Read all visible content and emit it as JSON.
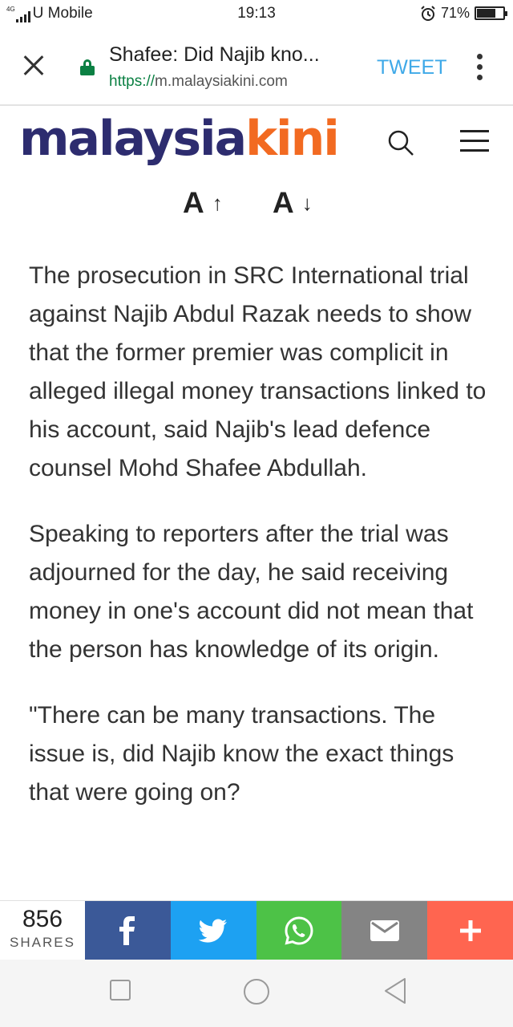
{
  "status_bar": {
    "network": "4G",
    "carrier": "U Mobile",
    "time": "19:13",
    "alarm_icon": "alarm-clock-icon",
    "battery_percent": "71%",
    "battery_level": 0.71
  },
  "browser": {
    "close_icon": "close-icon",
    "page_title": "Shafee: Did Najib kno...",
    "url_scheme": "https://",
    "url_host": "m.malaysiakini.com",
    "tweet_label": "TWEET",
    "menu_icon": "more-vert-icon",
    "secure_color": "#0b8043",
    "tweet_color": "#3fa9e8"
  },
  "site": {
    "logo_part1": "malaysia",
    "logo_part2": "kini",
    "logo_colors": [
      "#2d2c6f",
      "#f26a21"
    ],
    "search_icon": "search-icon",
    "menu_icon": "hamburger-icon"
  },
  "font_controls": {
    "increase_label": "A",
    "increase_arrow": "↑",
    "decrease_label": "A",
    "decrease_arrow": "↓"
  },
  "article": {
    "paragraphs": [
      "The prosecution in SRC International trial against Najib Abdul Razak needs to show that the former premier was complicit in alleged illegal money transactions linked to his account, said Najib's lead defence counsel Mohd Shafee Abdullah.",
      "Speaking to reporters after the trial was adjourned for the day, he said receiving money in one's account did not mean that the person has knowledge of its origin.",
      "\"There can be many transactions. The issue is, did Najib know the exact things that were going on?"
    ]
  },
  "share_bar": {
    "count": "856",
    "count_label": "SHARES",
    "buttons": [
      {
        "name": "facebook",
        "icon": "facebook-icon",
        "color": "#3b5998"
      },
      {
        "name": "twitter",
        "icon": "twitter-icon",
        "color": "#1da1f2"
      },
      {
        "name": "whatsapp",
        "icon": "whatsapp-icon",
        "color": "#4dc247"
      },
      {
        "name": "email",
        "icon": "email-icon",
        "color": "#848484"
      },
      {
        "name": "more",
        "icon": "plus-icon",
        "color": "#ff6550"
      }
    ]
  },
  "nav_bar": {
    "back_icon": "square-icon",
    "home_icon": "circle-icon",
    "recent_icon": "triangle-back-icon"
  }
}
